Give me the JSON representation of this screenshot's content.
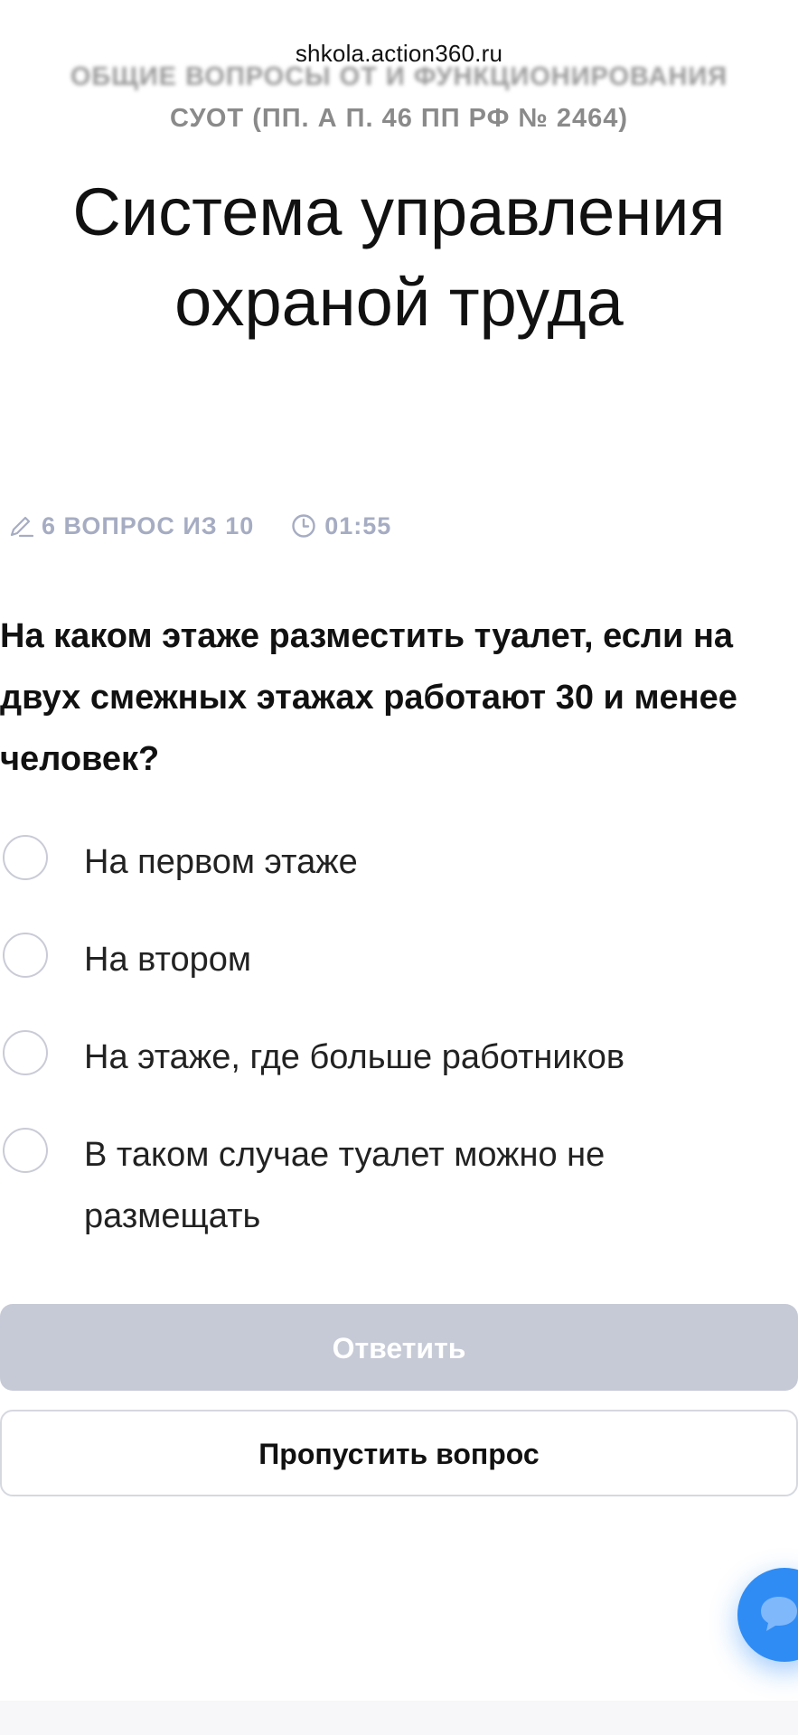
{
  "browser": {
    "url": "shkola.action360.ru"
  },
  "header": {
    "section_title_blurred": "Общие вопросы ОТ и функционирования",
    "section_title_line2": "СУОТ (пп. а п. 46 ПП РФ № 2464)",
    "main_title": "Система управления охраной труда"
  },
  "meta": {
    "progress_text": "6 вопрос из 10",
    "timer_text": "01:55",
    "progress_icon": "pencil-icon",
    "timer_icon": "clock-icon",
    "color": "#a6acc2"
  },
  "question": {
    "text": "На каком этаже разместить туалет, если на двух смежных этажах работают 30 и менее человек?"
  },
  "answers": [
    {
      "label": "На первом этаже",
      "selected": false
    },
    {
      "label": "На втором",
      "selected": false
    },
    {
      "label": "На этаже, где больше работников",
      "selected": false
    },
    {
      "label": "В таком случае туалет можно не размещать",
      "selected": false
    }
  ],
  "buttons": {
    "submit_label": "Ответить",
    "submit_disabled": true,
    "skip_label": "Пропустить вопрос"
  },
  "chat": {
    "icon": "chat-icon",
    "color": "#2f8cf5"
  },
  "colors": {
    "submit_bg": "#c6cad6",
    "radio_border": "#c9cbd6",
    "text": "#111111"
  }
}
